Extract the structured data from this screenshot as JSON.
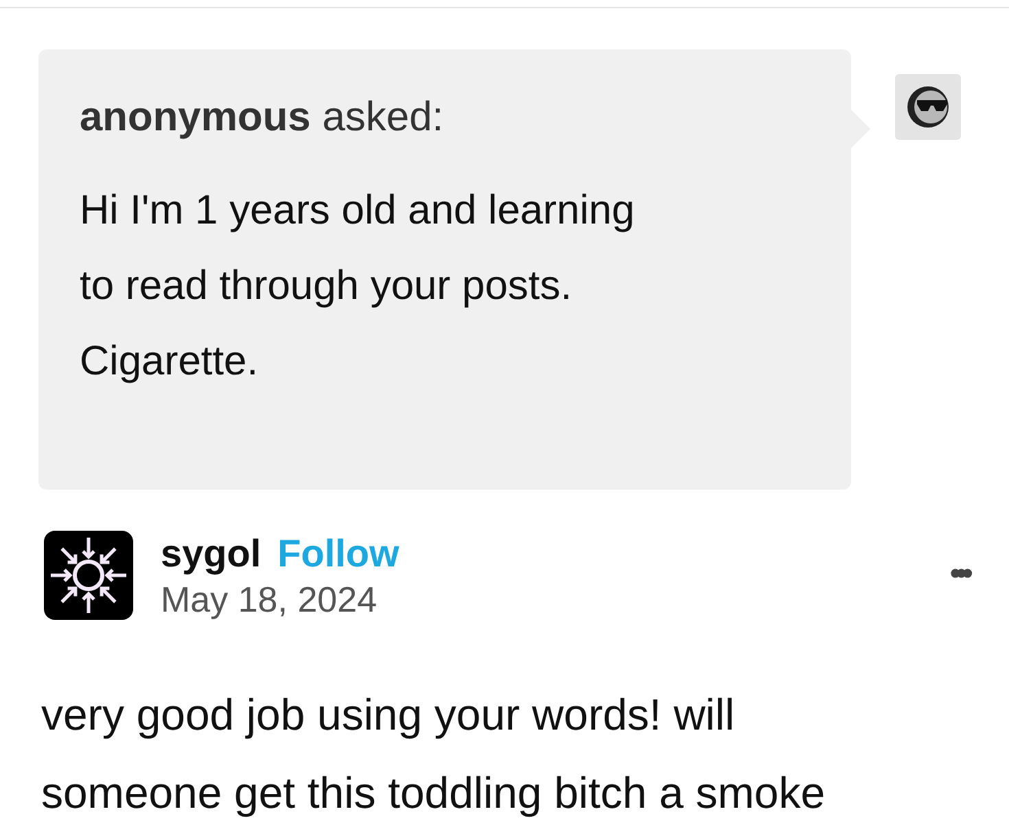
{
  "ask": {
    "asker": "anonymous",
    "verb": "asked:",
    "lines": [
      "Hi I'm 1 years old and learning",
      "to read through your posts.",
      "Cigarette."
    ]
  },
  "post": {
    "author": "sygol",
    "follow": "Follow",
    "date": "May 18, 2024",
    "more": "•••",
    "lines": [
      "very good job using your words! will",
      "someone get this toddling bitch a smoke"
    ]
  }
}
